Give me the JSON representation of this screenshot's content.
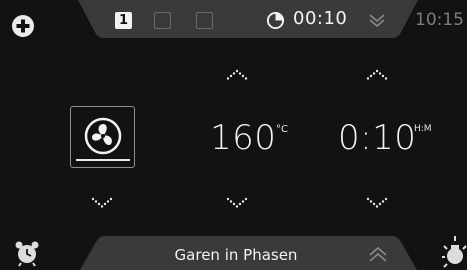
{
  "header": {
    "phases": [
      "1",
      "",
      ""
    ],
    "active_phase_label": "1",
    "timer": "00:10",
    "clock": "10:15"
  },
  "settings": {
    "temperature": {
      "value": "160",
      "unit": "°C"
    },
    "duration": {
      "value": "0:10",
      "unit": "H:M"
    }
  },
  "footer": {
    "program_label": "Garen in Phasen"
  },
  "icons": {
    "left_top": "add-icon",
    "mode": "fan-icon",
    "timer": "timer-icon",
    "header_expand": "chevron-down-icon",
    "footer_expand": "chevron-up-icon",
    "left_bottom": "alarm-clock-icon",
    "right_bottom": "oven-light-icon"
  },
  "colors": {
    "background": "#121212",
    "bar": "#3a3a3a",
    "text": "#f2f2f2",
    "muted": "#7d7d7d"
  }
}
